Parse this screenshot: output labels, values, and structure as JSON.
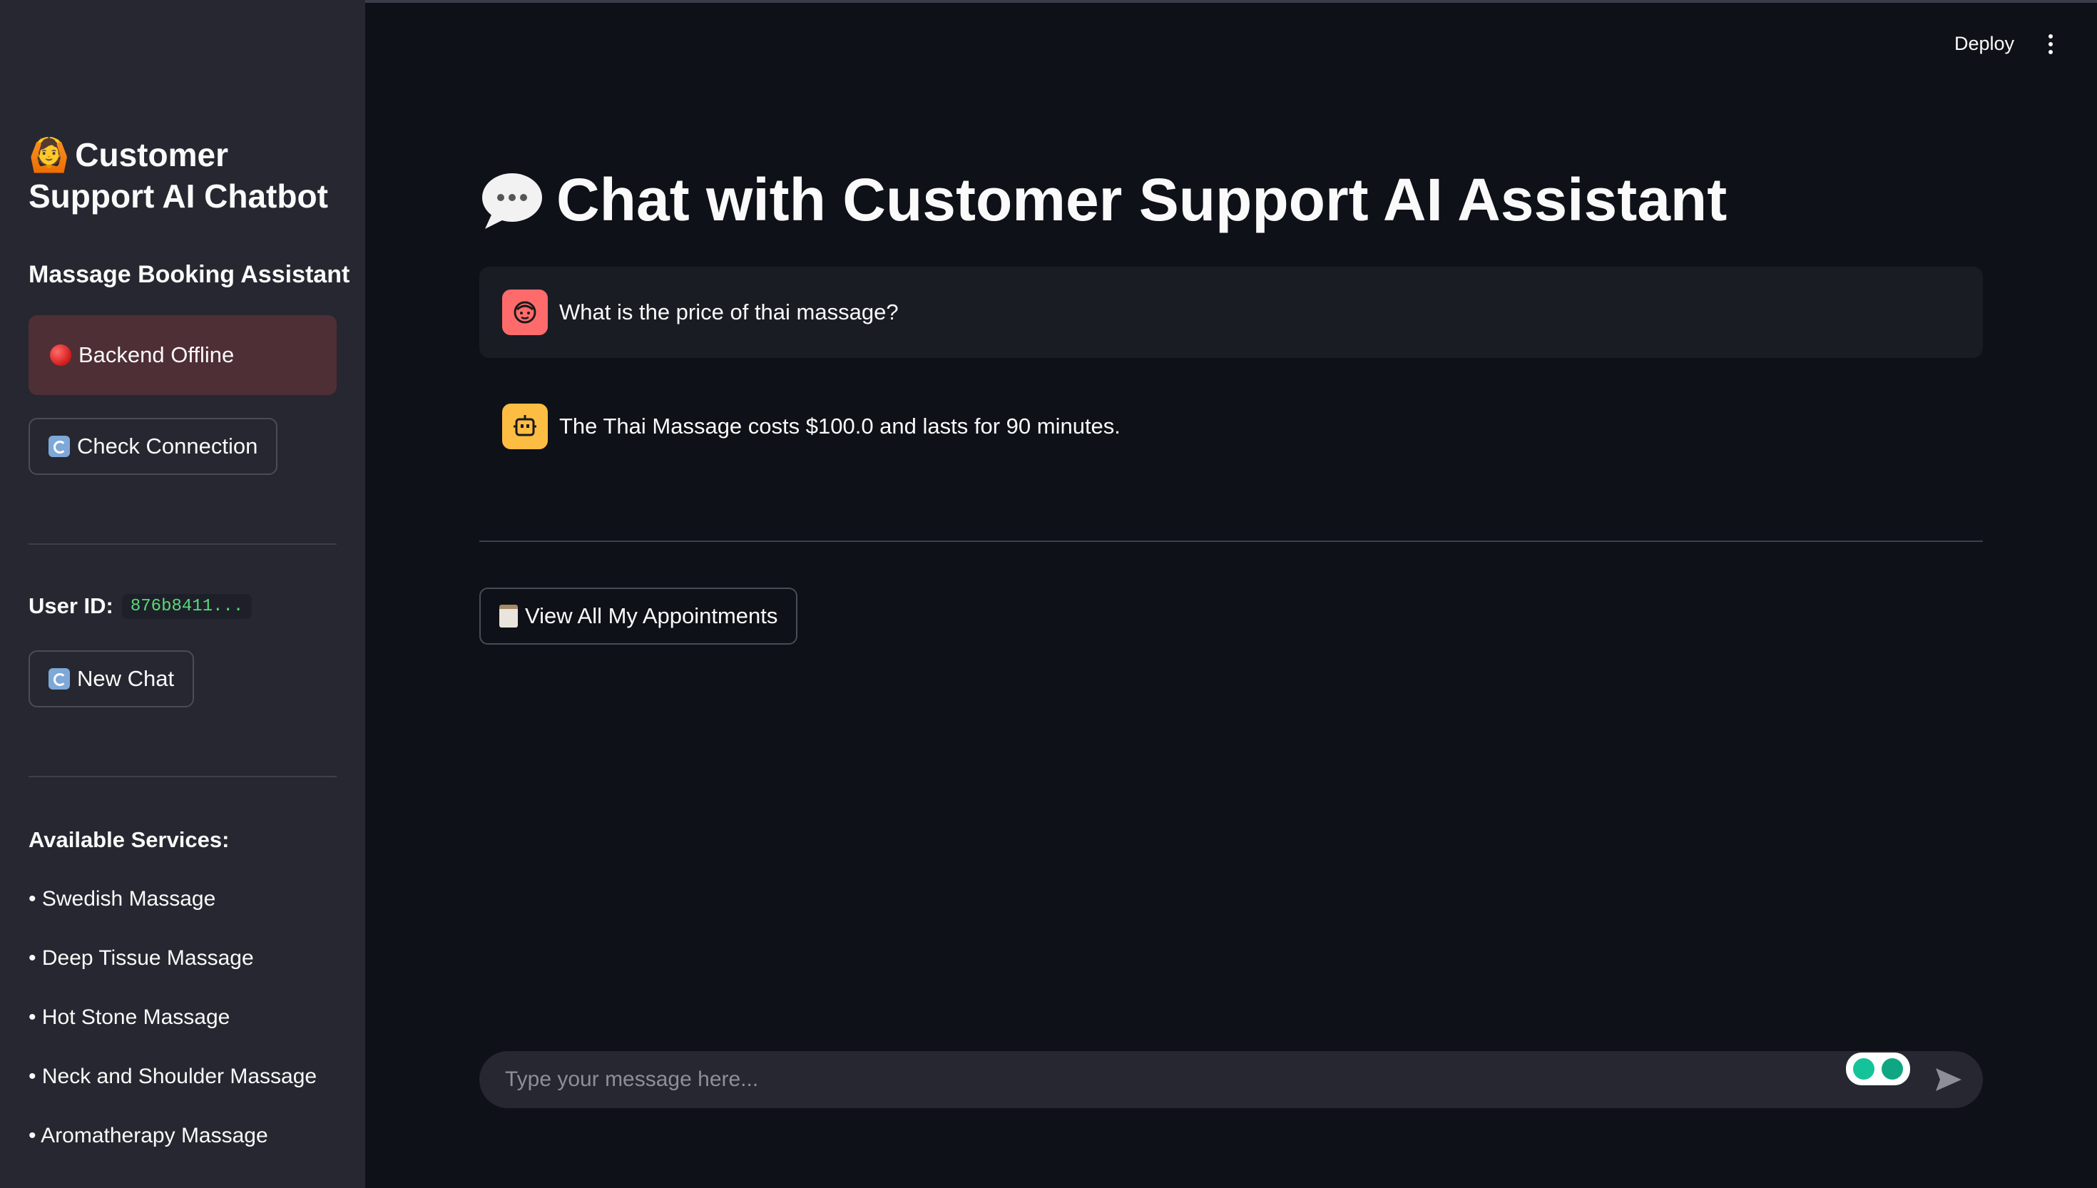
{
  "sidebar": {
    "title_emoji": "🙆",
    "title": "Customer Support AI Chatbot",
    "subtitle": "Massage Booking Assistant",
    "status_text": "Backend Offline",
    "check_connection_label": "Check Connection",
    "user_id_label": "User ID:",
    "user_id_value": "876b8411...",
    "new_chat_label": "New Chat",
    "services_title": "Available Services:",
    "services": [
      "• Swedish Massage",
      "• Deep Tissue Massage",
      "• Hot Stone Massage",
      "• Neck and Shoulder Massage",
      "• Aromatherapy Massage"
    ]
  },
  "header": {
    "deploy_label": "Deploy"
  },
  "main": {
    "title_emoji": "💬",
    "title": "Chat with Customer Support AI Assistant",
    "messages": [
      {
        "role": "user",
        "text": "What is the price of thai massage?"
      },
      {
        "role": "assistant",
        "text": "The Thai Massage costs $100.0 and lasts for 90 minutes."
      }
    ],
    "view_appointments_label": "View All My Appointments",
    "chat_input_placeholder": "Type your message here..."
  },
  "colors": {
    "background": "#0e1117",
    "sidebar": "#262730",
    "status_error_bg": "#4e2f35",
    "user_avatar": "#ff6b6b",
    "assistant_avatar": "#fdbd43",
    "user_id_code": "#5bd97a"
  }
}
